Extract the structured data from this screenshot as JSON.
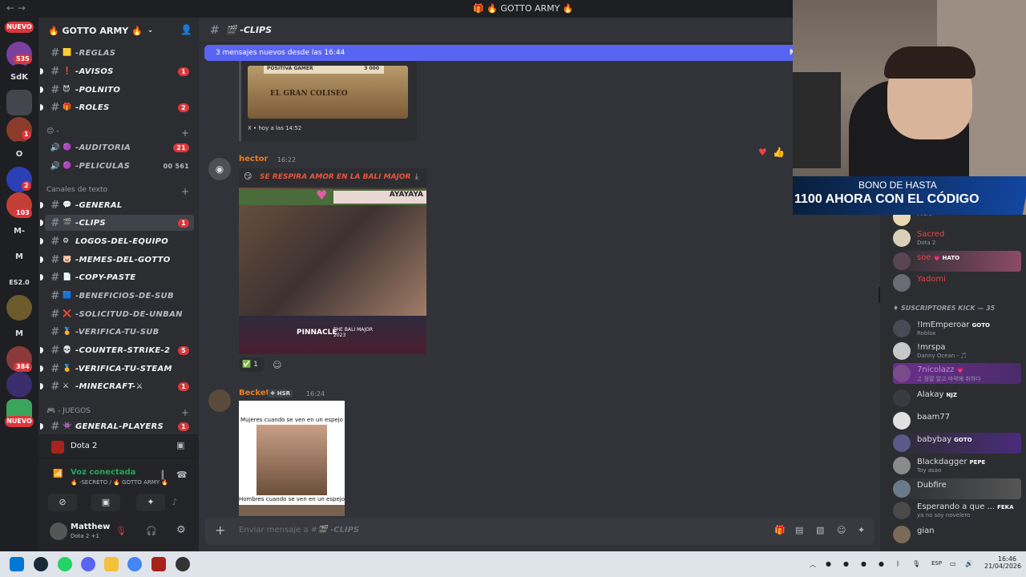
{
  "window": {
    "title": "🎁 🔥 GOTTO ARMY 🔥",
    "nav": "←  →"
  },
  "guilds": {
    "nuevo_label": "NUEVO",
    "items": [
      {
        "label": "",
        "badge": "535"
      },
      {
        "label": "SdK",
        "badge": ""
      },
      {
        "label": "",
        "badge": ""
      },
      {
        "label": "",
        "badge": "1"
      },
      {
        "label": "O",
        "badge": ""
      },
      {
        "label": "",
        "badge": "2"
      },
      {
        "label": "",
        "badge": "103"
      },
      {
        "label": "M-",
        "badge": ""
      },
      {
        "label": "M",
        "badge": ""
      },
      {
        "label": "ES2.0",
        "badge": ""
      },
      {
        "label": "",
        "badge": ""
      },
      {
        "label": "M",
        "badge": ""
      },
      {
        "label": "",
        "badge": "384"
      },
      {
        "label": "",
        "badge": ""
      },
      {
        "label": "",
        "badge": ""
      }
    ]
  },
  "server": {
    "name": "🔥 GOTTO ARMY 🔥"
  },
  "channels": {
    "top": [
      {
        "emoji": "🟨",
        "name": "-REGLAS",
        "count": ""
      },
      {
        "emoji": "❗",
        "name": "-AVISOS",
        "count": "1"
      },
      {
        "emoji": "😈",
        "name": "-POLNITO",
        "count": ""
      },
      {
        "emoji": "🎁",
        "name": "-ROLES",
        "count": "2"
      }
    ],
    "cat_voice": "😊 -",
    "voice": [
      {
        "emoji": "🟣",
        "name": "-AUDITORIA",
        "count": "21",
        "extra": ""
      },
      {
        "emoji": "🟣",
        "name": "-PELICULAS",
        "count": "",
        "extra": "00  561"
      }
    ],
    "cat_text": "Canales de texto",
    "text": [
      {
        "emoji": "💬",
        "name": "-GENERAL",
        "count": ""
      },
      {
        "emoji": "🎬",
        "name": "-CLIPS",
        "count": "1"
      },
      {
        "emoji": "⚙",
        "name": "LOGOS-DEL-EQUIPO",
        "count": ""
      },
      {
        "emoji": "🐷",
        "name": "-MEMES-DEL-GOTTO",
        "count": ""
      },
      {
        "emoji": "📄",
        "name": "-COPY-PASTE",
        "count": ""
      },
      {
        "emoji": "🟦",
        "name": "-BENEFICIOS-DE-SUB",
        "count": ""
      },
      {
        "emoji": "❌",
        "name": "-SOLICITUD-DE-UNBAN",
        "count": ""
      },
      {
        "emoji": "🏅",
        "name": "-VERIFICA-TU-SUB",
        "count": ""
      },
      {
        "emoji": "💀",
        "name": "-COUNTER-STRIKE-2",
        "count": "5"
      },
      {
        "emoji": "🏅",
        "name": "-VERIFICA-TU-STEAM",
        "count": ""
      },
      {
        "emoji": "⚔",
        "name": "-MINECRAFT-⚔",
        "count": "1"
      }
    ],
    "cat_games": "🎮 - JUEGOS",
    "games": [
      {
        "emoji": "👾",
        "name": "GENERAL-PLAYERS",
        "count": "1"
      }
    ]
  },
  "activity": {
    "game": "Dota 2"
  },
  "voice_status": {
    "title": "Voz conectada",
    "detail": "🔥 -SECRETO / 🔥 GOTTO ARMY 🔥"
  },
  "user": {
    "name": "Matthew",
    "status": "Dota 2 +1"
  },
  "header": {
    "channel": "🎬 -CLIPS"
  },
  "new_messages_bar": {
    "text": "3 mensajes nuevos desde las 16:44",
    "mark": "M"
  },
  "messages": {
    "embed": {
      "image_text_1": "POSITIVA GAMER",
      "image_text_2": "3 000",
      "image_text_3": "EL GRAN COLISEO",
      "footer": "X • hoy a las 14:52"
    },
    "m1": {
      "author": "hector",
      "time": "16:22",
      "video_title": "SE RESPIRA AMOR EN LA BALI MAJOR",
      "overlay": "AYAYAYA",
      "brand": "PINNACLE",
      "brand_sub": "THE BALI MAJOR 2023",
      "reaction_count": "1"
    },
    "m2": {
      "author": "Becket",
      "tag": "HSR",
      "time": "16:24",
      "top_text": "Mujeres cuando se ven en un espejo",
      "bottom_text": "Hombres cuando se ven en un espejo"
    }
  },
  "composer": {
    "placeholder_prefix": "Enviar mensaje a #",
    "placeholder_channel": "🎬 -CLIPS"
  },
  "webcam": {
    "line1": "BONO DE HASTA",
    "line2": "1100 AHORA CON EL CÓDIGO"
  },
  "members": {
    "top": [
      {
        "name": "Nao",
        "sub": "",
        "color": "#ed4245",
        "tag": ""
      },
      {
        "name": "Sacred",
        "sub": "Dota 2",
        "color": "#ed4245",
        "tag": ""
      },
      {
        "name": "soe",
        "sub": "",
        "color": "#ed4245",
        "tag": "💗 HATO"
      },
      {
        "name": "Yadomi",
        "sub": "",
        "color": "#ed4245",
        "tag": ""
      }
    ],
    "group": "SUSCRIPTORES KICK — 35",
    "list": [
      {
        "name": "!ImEmperoar",
        "sub": "Roblox",
        "color": "#dbdee1",
        "tag": "GOTO"
      },
      {
        "name": "!mrspa",
        "sub": "Danny Ocean - 🎵",
        "color": "#dbdee1",
        "tag": ""
      },
      {
        "name": "7nicolazz",
        "sub": "♫ 정말 알고 마약에 취하다",
        "color": "#c48de0",
        "tag": "💗"
      },
      {
        "name": "Alakay",
        "sub": "",
        "color": "#dbdee1",
        "tag": "NJZ"
      },
      {
        "name": "baam77",
        "sub": "",
        "color": "#dbdee1",
        "tag": ""
      },
      {
        "name": "babybay",
        "sub": "",
        "color": "#dbdee1",
        "tag": "GOTO"
      },
      {
        "name": "Blackdagger",
        "sub": "Toy asao",
        "color": "#dbdee1",
        "tag": "PEPE"
      },
      {
        "name": "Dubfire",
        "sub": "",
        "color": "#dbdee1",
        "tag": ""
      },
      {
        "name": "Esperando a que ...",
        "sub": "ya no soy novelero",
        "color": "#dbdee1",
        "tag": "FEKA"
      },
      {
        "name": "gian",
        "sub": "",
        "color": "#dbdee1",
        "tag": ""
      }
    ]
  },
  "taskbar": {
    "lang": "ESP",
    "time": "16:46",
    "date": "21/04/2026"
  }
}
